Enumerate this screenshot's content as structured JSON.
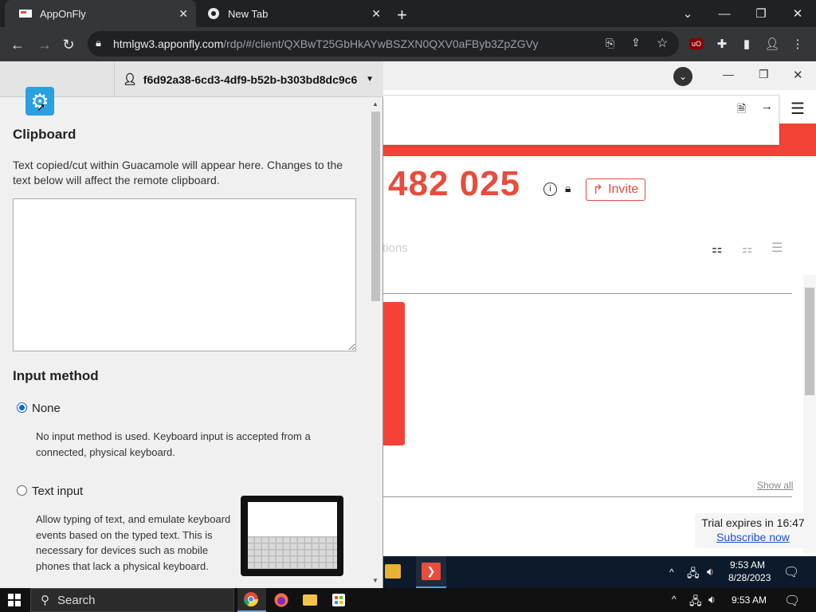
{
  "browser": {
    "tabs": [
      {
        "title": "AppOnFly",
        "active": true
      },
      {
        "title": "New Tab",
        "active": false
      }
    ],
    "new_tab_symbol": "+",
    "url_host": "htmlgw3.apponfly.com",
    "url_path": "/rdp/#/client/QXBwT25GbHkAYwBSZXN0QXV0aFByb3ZpZGVy",
    "extension_badge": "uO"
  },
  "guacamole": {
    "user": "f6d92a38-6cd3-4df9-b52b-b303bd8dc9c6",
    "clipboard_heading": "Clipboard",
    "clipboard_description": "Text copied/cut within Guacamole will appear here. Changes to the text below will affect the remote clipboard.",
    "clipboard_value": "",
    "input_method_heading": "Input method",
    "options": [
      {
        "label": "None",
        "selected": true,
        "description": "No input method is used. Keyboard input is accepted from a connected, physical keyboard."
      },
      {
        "label": "Text input",
        "selected": false,
        "description": "Allow typing of text, and emulate keyboard events based on the typed text. This is necessary for devices such as mobile phones that lack a physical keyboard."
      }
    ]
  },
  "remote": {
    "big_number": "482 025",
    "invite_label": "Invite",
    "partial_tab_label": "tions",
    "show_all": "Show all",
    "trial_text": "Trial expires in 16:47",
    "subscribe_label": "Subscribe now",
    "clock_time": "9:53 AM",
    "clock_date": "8/28/2023"
  },
  "taskbar": {
    "search_label": "Search",
    "clock_time": "9:53 AM"
  },
  "colors": {
    "accent_red": "#e74c3c",
    "guac_blue": "#29a0e0",
    "chrome_dark": "#202124"
  }
}
